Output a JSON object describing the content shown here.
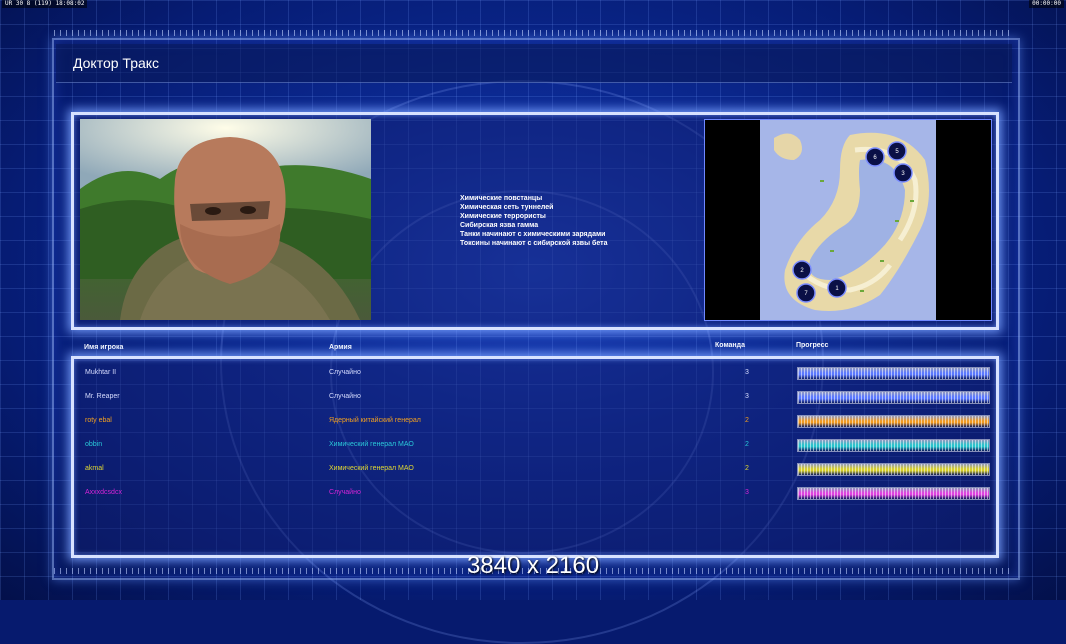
{
  "hud": {
    "left": "UR 30 8 (119) 18:08:02",
    "right": "00:00:00"
  },
  "title": "Доктор Тракс",
  "briefing": [
    "Химические повстанцы",
    "Химическая сеть туннелей",
    "Химические террористы",
    "Сибирская язва гамма",
    "Танки начинают с химическими зарядами",
    "Токсины начинают с сибирской язвы бета"
  ],
  "table": {
    "headers": {
      "player": "Имя игрока",
      "army": "Армия",
      "team": "Команда",
      "progress": "Прогресс"
    },
    "rows": [
      {
        "player": "Mukhtar II",
        "army": "Случайно",
        "team": "3",
        "color": "#d6dcff",
        "bar": "#5a78ff",
        "progress": 1.0
      },
      {
        "player": "Mr. Reaper",
        "army": "Случайно",
        "team": "3",
        "color": "#d6dcff",
        "bar": "#5a78ff",
        "progress": 1.0
      },
      {
        "player": "roty ebal",
        "army": "Ядерный китайский генерал",
        "team": "2",
        "color": "#f2a020",
        "bar": "#f29a20",
        "progress": 1.0
      },
      {
        "player": "obbin",
        "army": "Химический генерал МАО",
        "team": "2",
        "color": "#2ac8d8",
        "bar": "#28c4cc",
        "progress": 1.0
      },
      {
        "player": "akmal",
        "army": "Химический генерал МАО",
        "team": "2",
        "color": "#e0d832",
        "bar": "#d8d02a",
        "progress": 1.0
      },
      {
        "player": "Axxxdcsdcx",
        "army": "Случайно",
        "team": "3",
        "color": "#d624d6",
        "bar": "#e040e0",
        "progress": 1.0
      }
    ]
  },
  "map": {
    "spawns": [
      "1",
      "2",
      "3",
      "5",
      "6",
      "7"
    ]
  },
  "resolution_label": "3840 x 2160"
}
